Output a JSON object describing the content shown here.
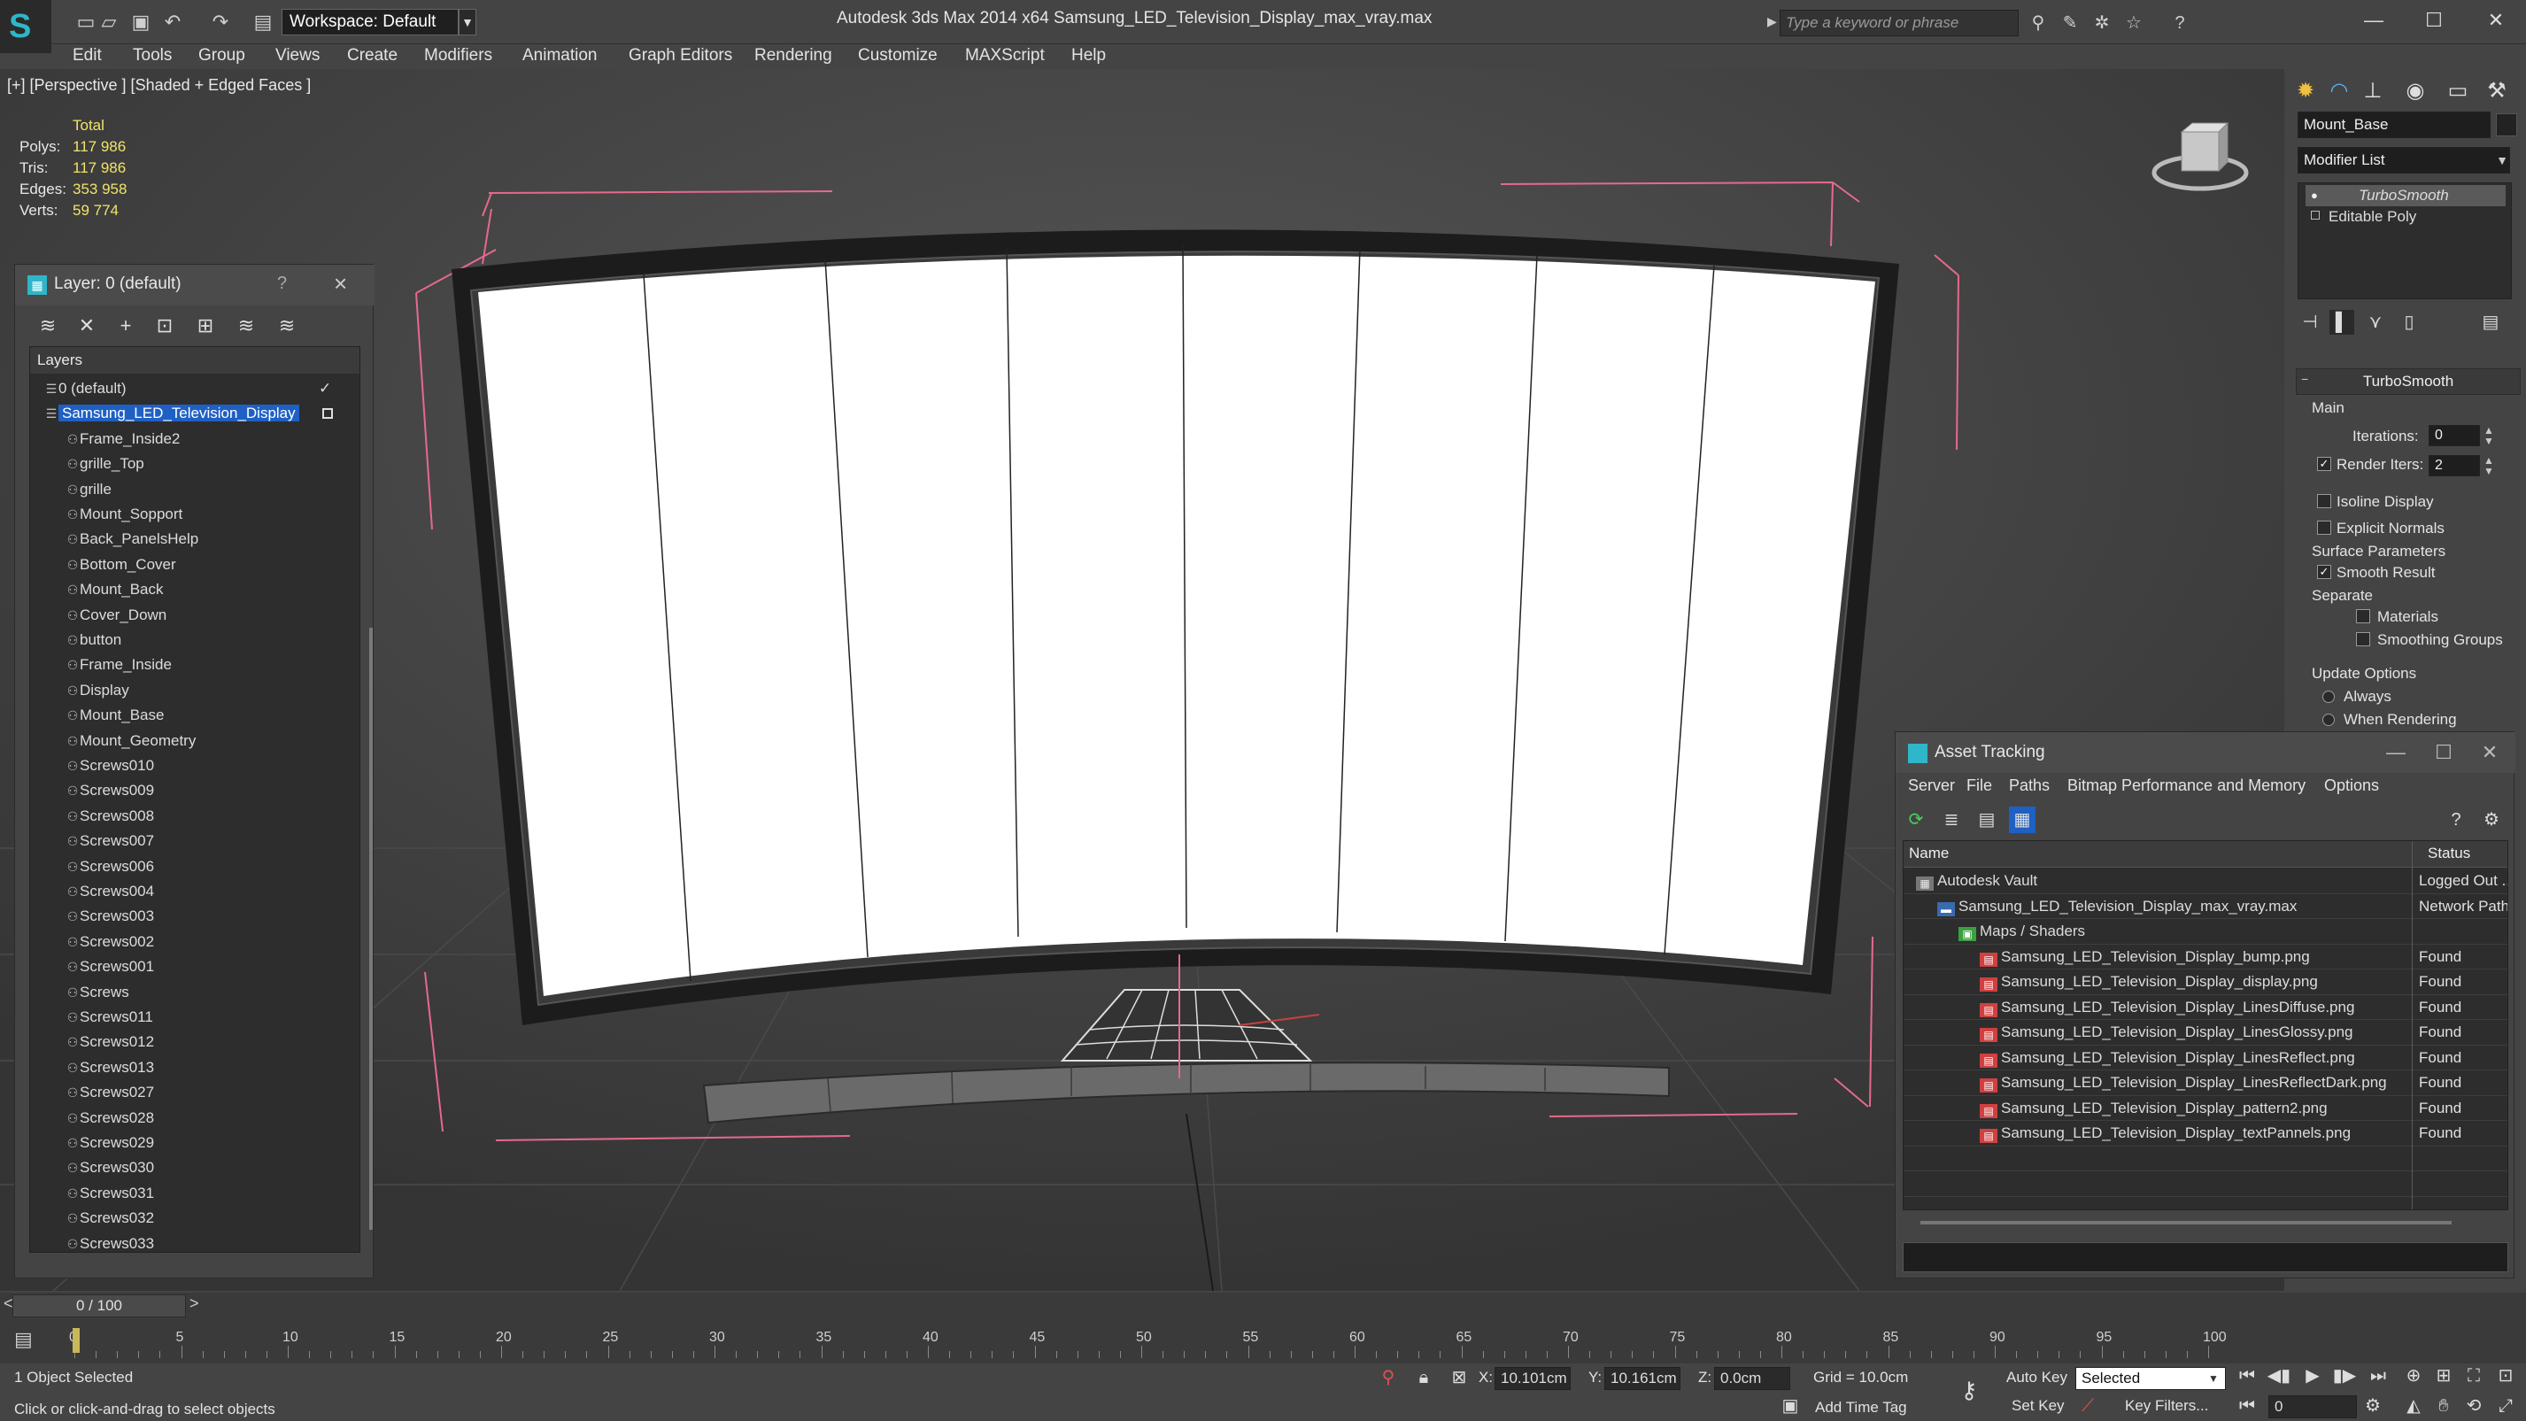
{
  "app": {
    "title": "Autodesk 3ds Max  2014 x64      Samsung_LED_Television_Display_max_vray.max",
    "workspace": "Workspace: Default",
    "search_placeholder": "Type a keyword or phrase"
  },
  "menu": [
    "Edit",
    "Tools",
    "Group",
    "Views",
    "Create",
    "Modifiers",
    "Animation",
    "Graph Editors",
    "Rendering",
    "Customize",
    "MAXScript",
    "Help"
  ],
  "viewport": {
    "label": "[+] [Perspective ] [Shaded + Edged Faces ]",
    "stats": {
      "header": "Total",
      "rows": [
        {
          "k": "Polys:",
          "v": "117 986"
        },
        {
          "k": "Tris:",
          "v": "117 986"
        },
        {
          "k": "Edges:",
          "v": "353 958"
        },
        {
          "k": "Verts:",
          "v": "59 774"
        }
      ]
    }
  },
  "layer_panel": {
    "title": "Layer: 0 (default)",
    "help": "?",
    "list_header": "Layers",
    "layers": [
      {
        "name": "0 (default)",
        "level": 1,
        "checked": true
      },
      {
        "name": "Samsung_LED_Television_Display",
        "level": 1,
        "selected": true
      },
      {
        "name": "Frame_Inside2",
        "level": 2
      },
      {
        "name": "grille_Top",
        "level": 2
      },
      {
        "name": "grille",
        "level": 2
      },
      {
        "name": "Mount_Sopport",
        "level": 2
      },
      {
        "name": "Back_PanelsHelp",
        "level": 2
      },
      {
        "name": "Bottom_Cover",
        "level": 2
      },
      {
        "name": "Mount_Back",
        "level": 2
      },
      {
        "name": "Cover_Down",
        "level": 2
      },
      {
        "name": "button",
        "level": 2
      },
      {
        "name": "Frame_Inside",
        "level": 2
      },
      {
        "name": "Display",
        "level": 2
      },
      {
        "name": "Mount_Base",
        "level": 2
      },
      {
        "name": "Mount_Geometry",
        "level": 2
      },
      {
        "name": "Screws010",
        "level": 2
      },
      {
        "name": "Screws009",
        "level": 2
      },
      {
        "name": "Screws008",
        "level": 2
      },
      {
        "name": "Screws007",
        "level": 2
      },
      {
        "name": "Screws006",
        "level": 2
      },
      {
        "name": "Screws004",
        "level": 2
      },
      {
        "name": "Screws003",
        "level": 2
      },
      {
        "name": "Screws002",
        "level": 2
      },
      {
        "name": "Screws001",
        "level": 2
      },
      {
        "name": "Screws",
        "level": 2
      },
      {
        "name": "Screws011",
        "level": 2
      },
      {
        "name": "Screws012",
        "level": 2
      },
      {
        "name": "Screws013",
        "level": 2
      },
      {
        "name": "Screws027",
        "level": 2
      },
      {
        "name": "Screws028",
        "level": 2
      },
      {
        "name": "Screws029",
        "level": 2
      },
      {
        "name": "Screws030",
        "level": 2
      },
      {
        "name": "Screws031",
        "level": 2
      },
      {
        "name": "Screws032",
        "level": 2
      },
      {
        "name": "Screws033",
        "level": 2
      }
    ]
  },
  "command_panel": {
    "object_name": "Mount_Base",
    "modifier_list": "Modifier List",
    "stack": [
      "TurboSmooth",
      "Editable Poly"
    ],
    "turbosmooth": {
      "rollout": "TurboSmooth",
      "main": "Main",
      "iterations_label": "Iterations:",
      "iterations": "0",
      "render_iters_label": "Render Iters:",
      "render_iters": "2",
      "isoline": "Isoline Display",
      "explicit_normals": "Explicit Normals",
      "surface_params": "Surface Parameters",
      "smooth_result": "Smooth Result",
      "separate": "Separate",
      "materials": "Materials",
      "smoothing_groups": "Smoothing Groups",
      "update_options": "Update Options",
      "always": "Always",
      "when_rendering": "When Rendering"
    }
  },
  "asset_tracking": {
    "title": "Asset Tracking",
    "menu": [
      "Server",
      "File",
      "Paths",
      "Bitmap Performance and Memory",
      "Options"
    ],
    "col_name": "Name",
    "col_status": "Status",
    "rows": [
      {
        "name": "Autodesk Vault",
        "status": "Logged Out ...",
        "indent": 1,
        "icon": "vault"
      },
      {
        "name": "Samsung_LED_Television_Display_max_vray.max",
        "status": "Network Path",
        "indent": 2,
        "icon": "max"
      },
      {
        "name": "Maps / Shaders",
        "status": "",
        "indent": 3,
        "icon": "maps"
      },
      {
        "name": "Samsung_LED_Television_Display_bump.png",
        "status": "Found",
        "indent": 4,
        "icon": "png"
      },
      {
        "name": "Samsung_LED_Television_Display_display.png",
        "status": "Found",
        "indent": 4,
        "icon": "png"
      },
      {
        "name": "Samsung_LED_Television_Display_LinesDiffuse.png",
        "status": "Found",
        "indent": 4,
        "icon": "png"
      },
      {
        "name": "Samsung_LED_Television_Display_LinesGlossy.png",
        "status": "Found",
        "indent": 4,
        "icon": "png"
      },
      {
        "name": "Samsung_LED_Television_Display_LinesReflect.png",
        "status": "Found",
        "indent": 4,
        "icon": "png"
      },
      {
        "name": "Samsung_LED_Television_Display_LinesReflectDark.png",
        "status": "Found",
        "indent": 4,
        "icon": "png"
      },
      {
        "name": "Samsung_LED_Television_Display_pattern2.png",
        "status": "Found",
        "indent": 4,
        "icon": "png"
      },
      {
        "name": "Samsung_LED_Television_Display_textPannels.png",
        "status": "Found",
        "indent": 4,
        "icon": "png"
      }
    ]
  },
  "timeline": {
    "position": "0 / 100",
    "prev": "<",
    "next": ">",
    "labels": [
      "0",
      "5",
      "10",
      "15",
      "20",
      "25",
      "30",
      "35",
      "40",
      "45",
      "50",
      "55",
      "60",
      "65",
      "70",
      "75",
      "80",
      "85",
      "90",
      "95",
      "100"
    ]
  },
  "status": {
    "selection": "1 Object Selected",
    "prompt": "Click or click-and-drag to select objects",
    "x_label": "X:",
    "x": "10.101cm",
    "y_label": "Y:",
    "y": "10.161cm",
    "z_label": "Z:",
    "z": "0.0cm",
    "grid": "Grid = 10.0cm",
    "auto_key": "Auto Key",
    "selected": "Selected",
    "set_key": "Set Key",
    "key_filters": "Key Filters...",
    "add_time_tag": "Add Time Tag",
    "frame": "0"
  }
}
